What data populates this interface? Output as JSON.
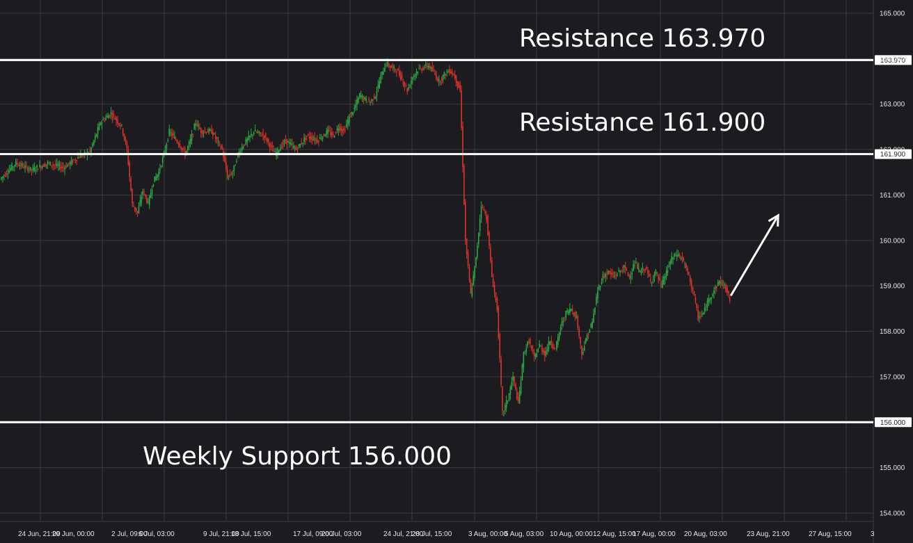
{
  "chart_data": {
    "type": "line",
    "title": "",
    "xlabel": "",
    "ylabel": "",
    "ylim": [
      154.0,
      165.0
    ],
    "y_ticks": [
      "154.000",
      "155.000",
      "156.000",
      "157.000",
      "158.000",
      "159.000",
      "160.000",
      "161.000",
      "162.000",
      "163.000",
      "164.000",
      "165.000"
    ],
    "x_tick_labels": [
      "24 Jun, 21:00",
      "29 Jun, 00:00",
      "2 Jul, 09:00",
      "6 Jul, 03:00",
      "9 Jul, 21:00",
      "13 Jul, 15:00",
      "17 Jul, 09:00",
      "20 Jul, 03:00",
      "24 Jul, 21:00",
      "28 Jul, 15:00",
      "3 Aug, 00:00",
      "5 Aug, 03:00",
      "10 Aug, 00:00",
      "12 Aug, 15:00",
      "17 Aug, 00:00",
      "20 Aug, 03:00",
      "23 Aug, 21:00",
      "27 Aug, 15:00",
      "3"
    ],
    "grid": true,
    "series_color_up": "#2eaa44",
    "series_color_down": "#e0332a",
    "price_path": [
      [
        0,
        161.35
      ],
      [
        3,
        161.7
      ],
      [
        6,
        161.55
      ],
      [
        9,
        161.7
      ],
      [
        12,
        161.6
      ],
      [
        15,
        161.85
      ],
      [
        17,
        161.95
      ],
      [
        19,
        162.6
      ],
      [
        21,
        162.8
      ],
      [
        23,
        162.5
      ],
      [
        24,
        162.0
      ],
      [
        25,
        160.8
      ],
      [
        26,
        160.6
      ],
      [
        27,
        161.1
      ],
      [
        28,
        160.8
      ],
      [
        29,
        161.3
      ],
      [
        30,
        161.5
      ],
      [
        31,
        161.9
      ],
      [
        32,
        162.4
      ],
      [
        34,
        162.1
      ],
      [
        35,
        161.9
      ],
      [
        36,
        162.2
      ],
      [
        37,
        162.6
      ],
      [
        38,
        162.4
      ],
      [
        40,
        162.4
      ],
      [
        42,
        162.0
      ],
      [
        43,
        161.4
      ],
      [
        44,
        161.5
      ],
      [
        45,
        161.9
      ],
      [
        46,
        162.1
      ],
      [
        48,
        162.4
      ],
      [
        50,
        162.3
      ],
      [
        52,
        161.9
      ],
      [
        54,
        162.2
      ],
      [
        56,
        162.0
      ],
      [
        58,
        162.3
      ],
      [
        60,
        162.2
      ],
      [
        62,
        162.4
      ],
      [
        63,
        162.3
      ],
      [
        64,
        162.5
      ],
      [
        65,
        162.4
      ],
      [
        66,
        162.7
      ],
      [
        67,
        162.9
      ],
      [
        68,
        163.2
      ],
      [
        69,
        163.1
      ],
      [
        70,
        163.05
      ],
      [
        71,
        163.2
      ],
      [
        72,
        163.6
      ],
      [
        73,
        163.9
      ],
      [
        74,
        163.8
      ],
      [
        75,
        163.75
      ],
      [
        76,
        163.55
      ],
      [
        77,
        163.3
      ],
      [
        78,
        163.6
      ],
      [
        79,
        163.75
      ],
      [
        80,
        163.8
      ],
      [
        81,
        163.85
      ],
      [
        82,
        163.7
      ],
      [
        83,
        163.5
      ],
      [
        84,
        163.65
      ],
      [
        85,
        163.75
      ],
      [
        86,
        163.6
      ],
      [
        87,
        163.3
      ],
      [
        88,
        160.0
      ],
      [
        89,
        158.8
      ],
      [
        90,
        159.6
      ],
      [
        91,
        160.8
      ],
      [
        92,
        160.5
      ],
      [
        93,
        159.2
      ],
      [
        94,
        158.5
      ],
      [
        95,
        156.2
      ],
      [
        96,
        156.5
      ],
      [
        97,
        157.0
      ],
      [
        98,
        156.4
      ],
      [
        99,
        157.5
      ],
      [
        100,
        157.8
      ],
      [
        101,
        157.4
      ],
      [
        102,
        157.7
      ],
      [
        103,
        157.5
      ],
      [
        104,
        157.8
      ],
      [
        105,
        157.6
      ],
      [
        106,
        158.1
      ],
      [
        107,
        158.4
      ],
      [
        108,
        158.5
      ],
      [
        109,
        158.3
      ],
      [
        110,
        157.5
      ],
      [
        111,
        157.9
      ],
      [
        112,
        158.2
      ],
      [
        113,
        158.9
      ],
      [
        114,
        159.2
      ],
      [
        115,
        159.3
      ],
      [
        116,
        159.2
      ],
      [
        117,
        159.3
      ],
      [
        118,
        159.4
      ],
      [
        119,
        159.2
      ],
      [
        120,
        159.5
      ],
      [
        121,
        159.3
      ],
      [
        122,
        159.4
      ],
      [
        123,
        159.1
      ],
      [
        124,
        159.3
      ],
      [
        125,
        159.0
      ],
      [
        126,
        159.3
      ],
      [
        127,
        159.6
      ],
      [
        128,
        159.7
      ],
      [
        129,
        159.6
      ],
      [
        130,
        159.3
      ],
      [
        131,
        158.9
      ],
      [
        132,
        158.3
      ],
      [
        133,
        158.4
      ],
      [
        134,
        158.7
      ],
      [
        135,
        158.9
      ],
      [
        136,
        159.1
      ],
      [
        137,
        159.0
      ],
      [
        138,
        158.7
      ]
    ],
    "levels": [
      {
        "value": 163.97,
        "tag": "163.970",
        "label": "Resistance 163.970"
      },
      {
        "value": 161.9,
        "tag": "161.900",
        "label": "Resistance 161.900"
      },
      {
        "value": 156.0,
        "tag": "156.000",
        "label": "Weekly Support 156.000"
      }
    ],
    "projection_arrow": {
      "from": [
        138,
        158.8
      ],
      "to": [
        147,
        160.55
      ],
      "color": "#ffffff"
    }
  }
}
